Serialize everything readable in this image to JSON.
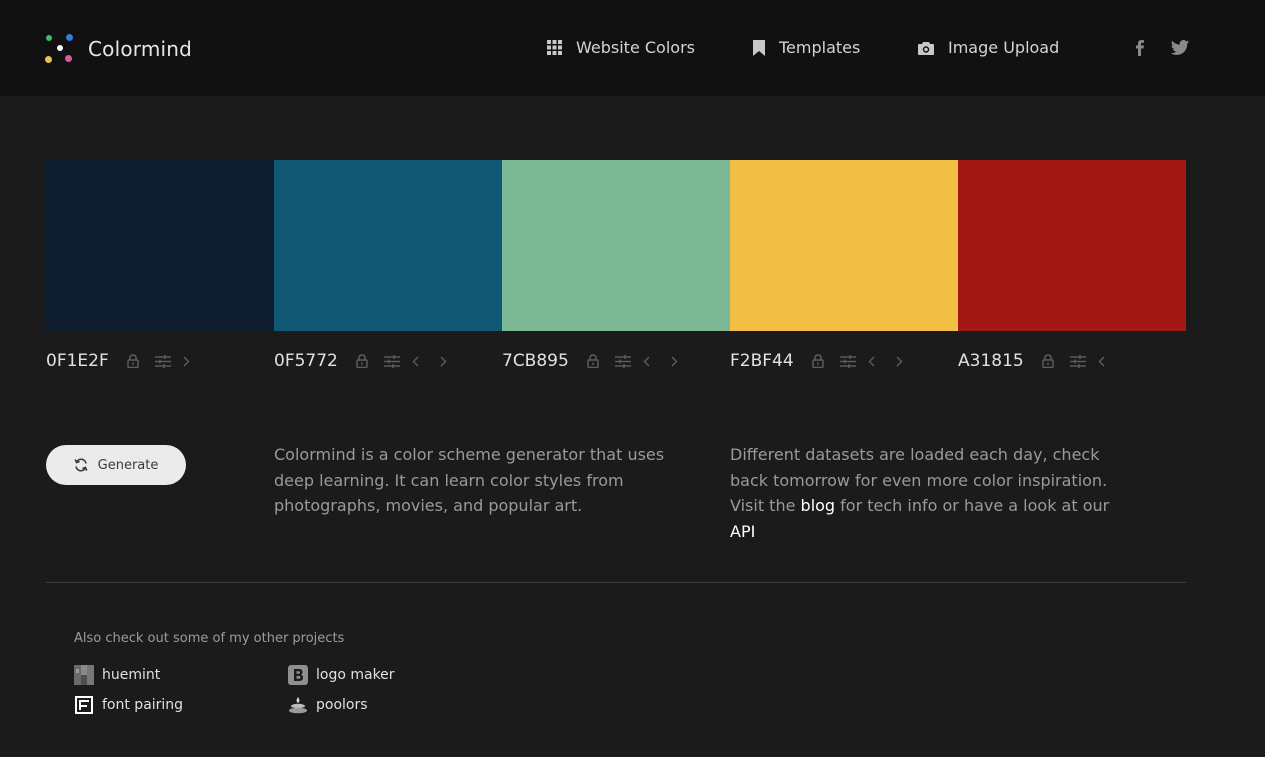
{
  "header": {
    "brand": "Colormind",
    "nav": [
      {
        "label": "Website Colors",
        "icon": "grid-icon"
      },
      {
        "label": "Templates",
        "icon": "bookmark-icon"
      },
      {
        "label": "Image Upload",
        "icon": "camera-icon"
      }
    ],
    "social": [
      {
        "icon": "facebook-icon"
      },
      {
        "icon": "twitter-icon"
      }
    ]
  },
  "palette": {
    "colors": [
      {
        "hex": "0F1E2F",
        "color": "#0F1E2F",
        "controls": [
          "lock-icon",
          "adjust-icon",
          "chevron-right-icon"
        ]
      },
      {
        "hex": "0F5772",
        "color": "#0F5772",
        "controls": [
          "lock-icon",
          "adjust-icon",
          "chevron-left-icon",
          "chevron-right-icon"
        ]
      },
      {
        "hex": "7CB895",
        "color": "#7CB895",
        "controls": [
          "lock-icon",
          "adjust-icon",
          "chevron-left-icon",
          "chevron-right-icon"
        ]
      },
      {
        "hex": "F2BF44",
        "color": "#F2BF44",
        "controls": [
          "lock-icon",
          "adjust-icon",
          "chevron-left-icon",
          "chevron-right-icon"
        ]
      },
      {
        "hex": "A31815",
        "color": "#A31815",
        "controls": [
          "lock-icon",
          "adjust-icon",
          "chevron-left-icon"
        ]
      }
    ]
  },
  "generate": {
    "label": "Generate",
    "icon": "refresh-icon"
  },
  "description": {
    "left": "Colormind is a color scheme generator that uses deep learning. It can learn color styles from photographs, movies, and popular art.",
    "right_prefix": "Different datasets are loaded each day, check back tomorrow for even more color inspiration. Visit the ",
    "blog_link": "blog",
    "right_middle": " for tech info or have a look at our ",
    "api_link": "API"
  },
  "footer": {
    "heading": "Also check out some of my other projects",
    "projects": [
      {
        "label": "huemint",
        "icon": "huemint-icon"
      },
      {
        "label": "logo maker",
        "icon": "logo-maker-icon"
      },
      {
        "label": "font pairing",
        "icon": "font-pairing-icon"
      },
      {
        "label": "poolors",
        "icon": "poolors-icon"
      }
    ]
  },
  "colors": {
    "background": "#1b1b1b",
    "header": "#111111",
    "button": "#ebebeb",
    "muted_text": "#9a9a9a"
  }
}
